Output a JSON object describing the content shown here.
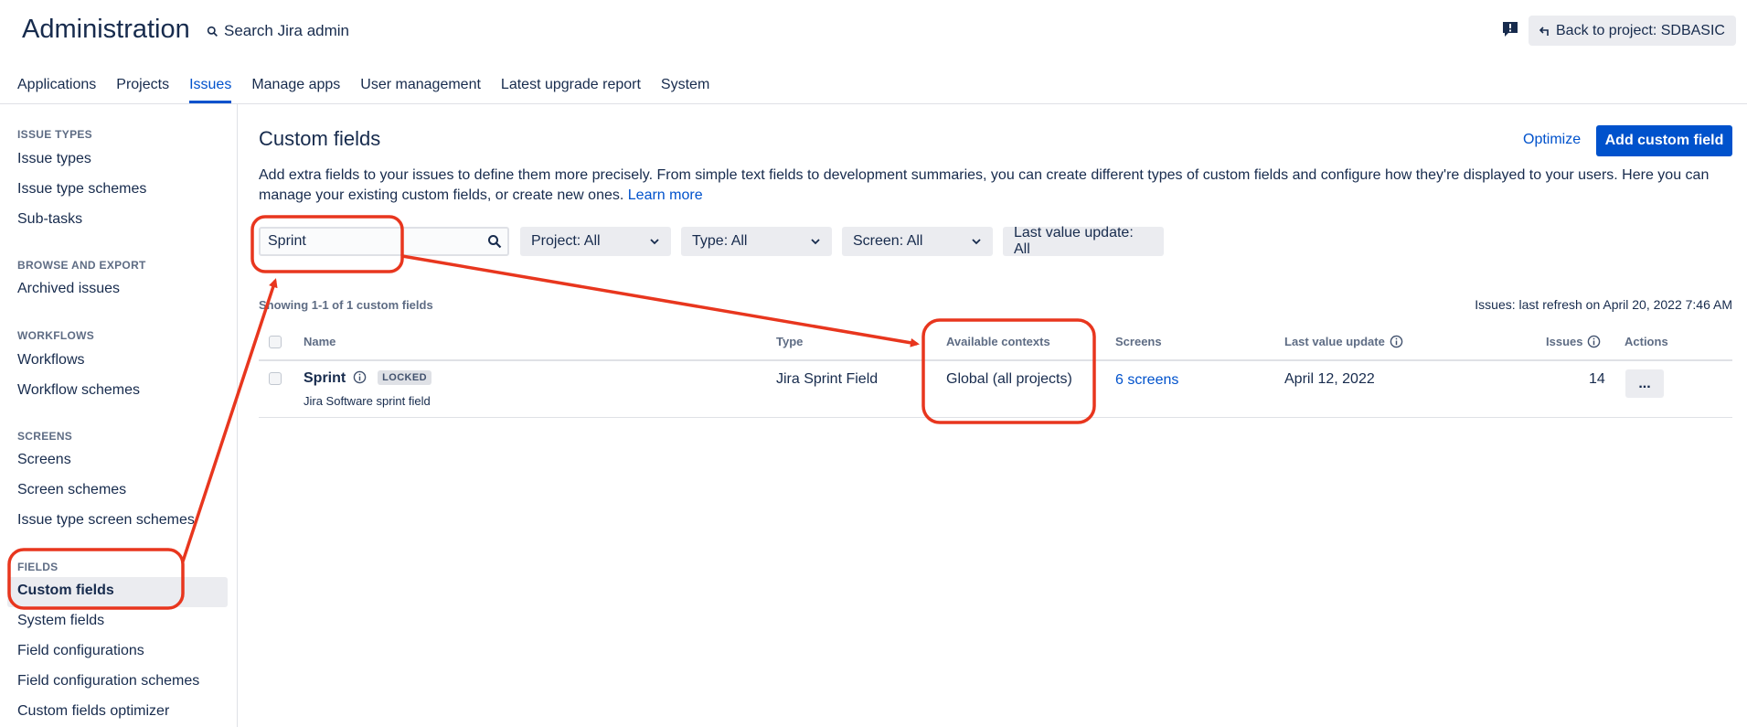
{
  "header": {
    "title": "Administration",
    "search_label": "Search Jira admin",
    "back_button": "Back to project: SDBASIC",
    "feedback_icon": "feedback-icon"
  },
  "nav": {
    "tabs": [
      {
        "label": "Applications"
      },
      {
        "label": "Projects"
      },
      {
        "label": "Issues",
        "active": true
      },
      {
        "label": "Manage apps"
      },
      {
        "label": "User management"
      },
      {
        "label": "Latest upgrade report"
      },
      {
        "label": "System"
      }
    ]
  },
  "sidebar": {
    "sections": [
      {
        "title": "ISSUE TYPES",
        "items": [
          "Issue types",
          "Issue type schemes",
          "Sub-tasks"
        ]
      },
      {
        "title": "BROWSE AND EXPORT",
        "items": [
          "Archived issues"
        ]
      },
      {
        "title": "WORKFLOWS",
        "items": [
          "Workflows",
          "Workflow schemes"
        ]
      },
      {
        "title": "SCREENS",
        "items": [
          "Screens",
          "Screen schemes",
          "Issue type screen schemes"
        ]
      },
      {
        "title": "FIELDS",
        "items": [
          "Custom fields",
          "System fields",
          "Field configurations",
          "Field configuration schemes",
          "Custom fields optimizer"
        ]
      }
    ],
    "selected": "Custom fields"
  },
  "main": {
    "title": "Custom fields",
    "optimize_label": "Optimize",
    "add_button": "Add custom field",
    "description": "Add extra fields to your issues to define them more precisely. From simple text fields to development summaries, you can create different types of custom fields and configure how they're displayed to your users. Here you can manage your existing custom fields, or create new ones.",
    "learn_more": "Learn more",
    "search_value": "Sprint",
    "filters": {
      "project": "Project: All",
      "type": "Type: All",
      "screen": "Screen: All",
      "last_value": "Last value update: All"
    },
    "showing": "Showing 1-1 of 1 custom fields",
    "refresh": "Issues: last refresh on April 20, 2022 7:46 AM"
  },
  "table": {
    "columns": {
      "name": "Name",
      "type": "Type",
      "contexts": "Available contexts",
      "screens": "Screens",
      "last_update": "Last value update",
      "issues": "Issues",
      "actions": "Actions"
    },
    "rows": [
      {
        "name": "Sprint",
        "badge": "LOCKED",
        "description": "Jira Software sprint field",
        "type": "Jira Sprint Field",
        "contexts": "Global (all projects)",
        "screens": "6 screens",
        "last_update": "April 12, 2022",
        "issues": "14",
        "actions": "..."
      }
    ]
  },
  "annotation_color": "#E8361E",
  "accent_color": "#0052CC"
}
